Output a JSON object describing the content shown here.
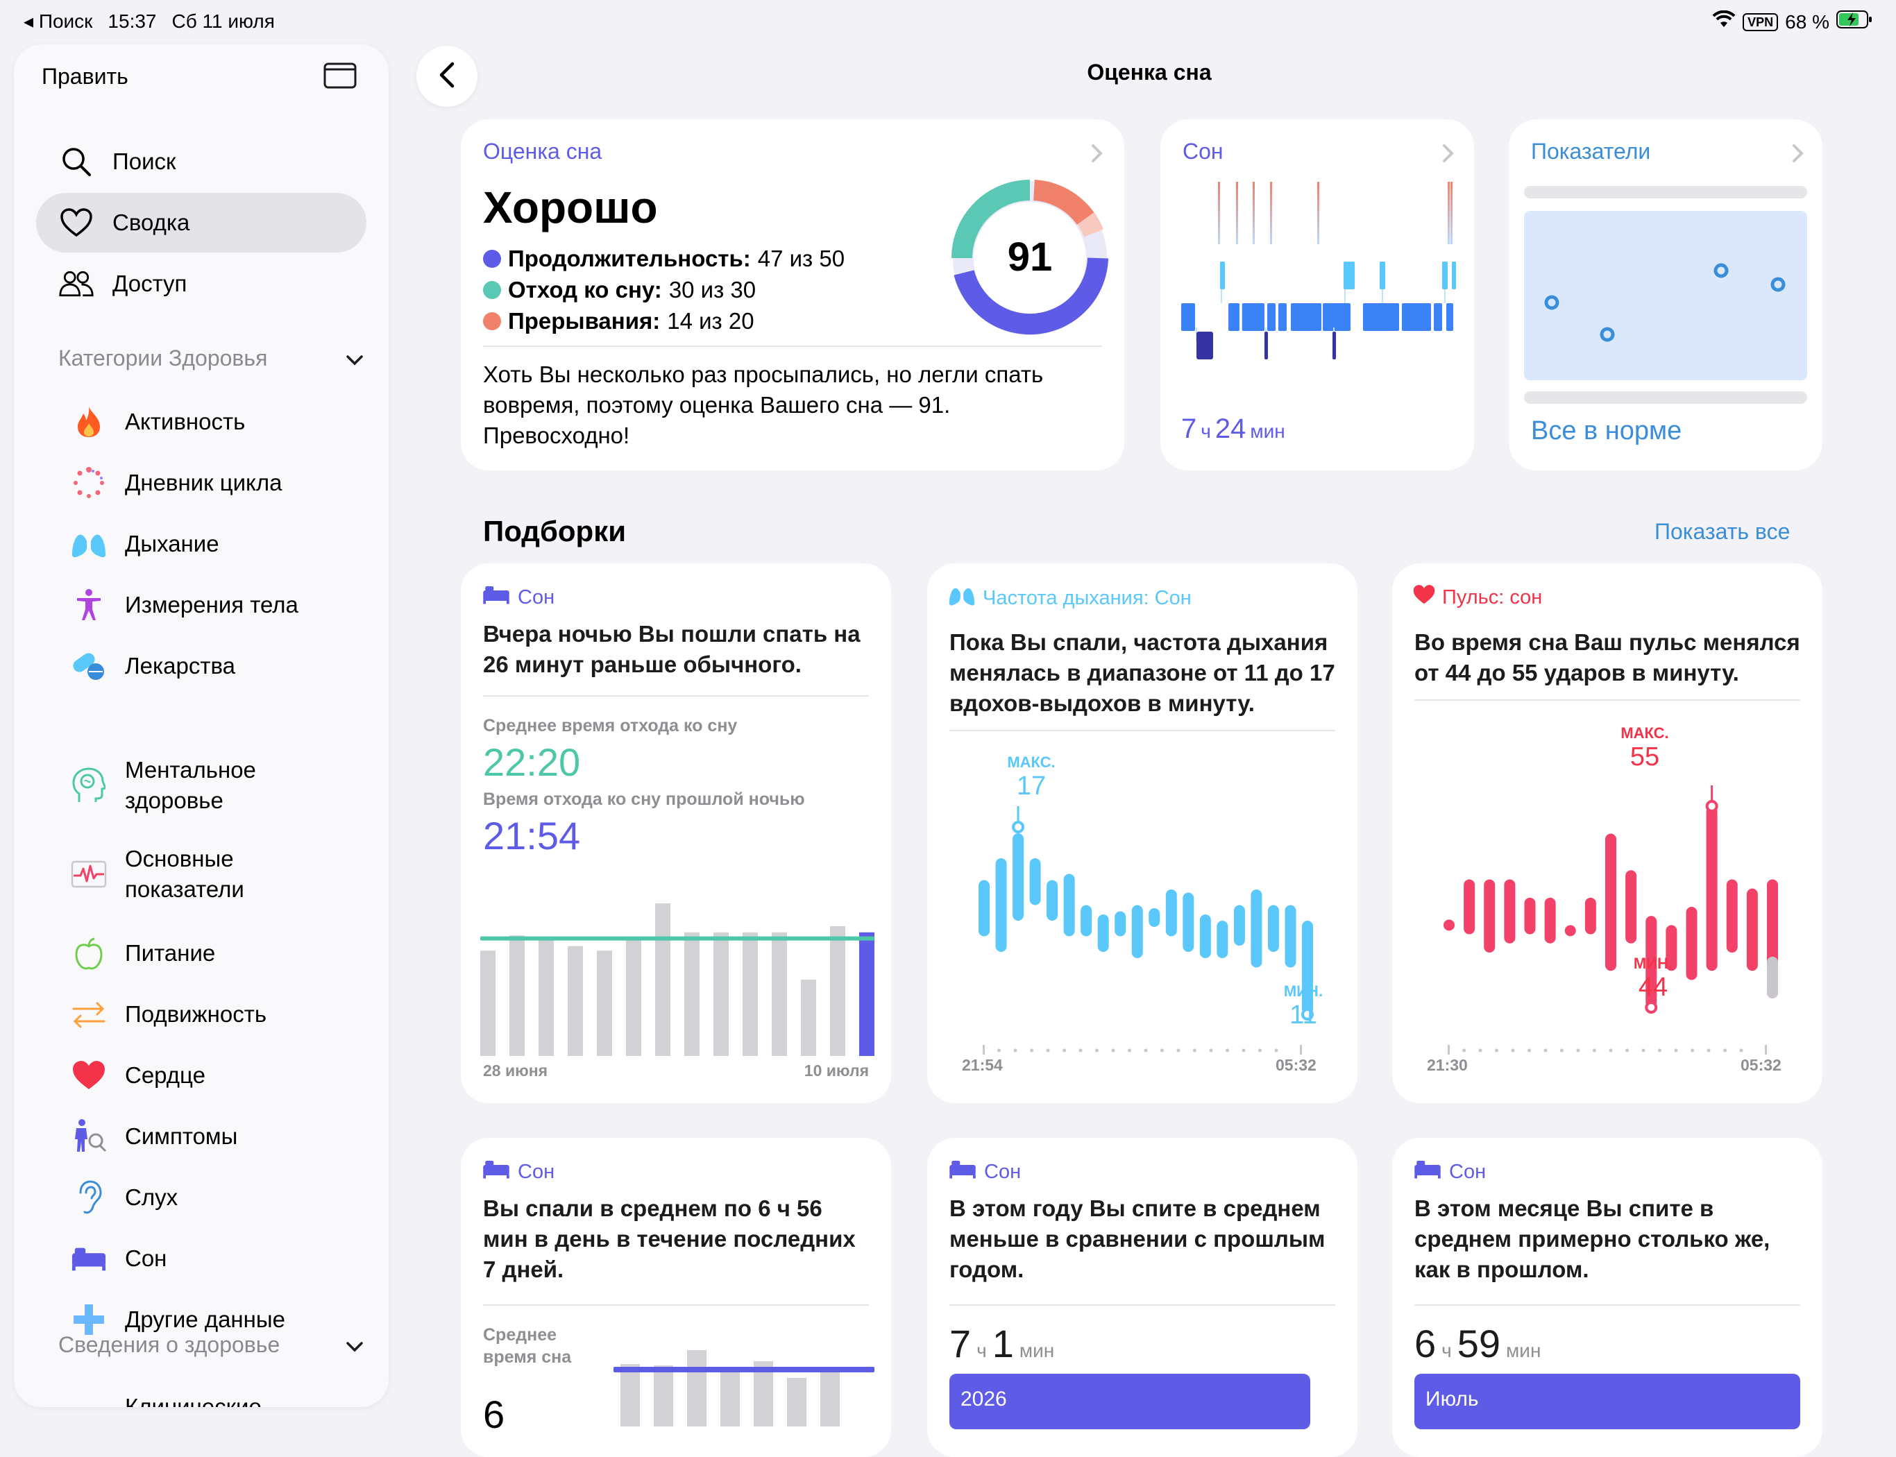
{
  "status_bar": {
    "back_app": "◂ Поиск",
    "time": "15:37",
    "date": "Сб 11 июля",
    "vpn": "VPN",
    "battery": "68 %"
  },
  "sidebar": {
    "edit": "Править",
    "items": [
      {
        "label": "Поиск",
        "icon": "search-icon"
      },
      {
        "label": "Сводка",
        "icon": "heart-outline-icon",
        "selected": true
      },
      {
        "label": "Доступ",
        "icon": "people-icon"
      }
    ],
    "categories_header": "Категории Здоровья",
    "categories": [
      {
        "label": "Активность",
        "icon": "flame-icon"
      },
      {
        "label": "Дневник цикла",
        "icon": "cycle-icon"
      },
      {
        "label": "Дыхание",
        "icon": "lungs-icon"
      },
      {
        "label": "Измерения тела",
        "icon": "body-icon"
      },
      {
        "label": "Лекарства",
        "icon": "pills-icon"
      },
      {
        "label": "Ментальное здоровье",
        "icon": "brain-head-icon"
      },
      {
        "label": "Основные показатели",
        "icon": "vitals-icon"
      },
      {
        "label": "Питание",
        "icon": "apple-icon"
      },
      {
        "label": "Подвижность",
        "icon": "arrows-icon"
      },
      {
        "label": "Сердце",
        "icon": "heart-icon"
      },
      {
        "label": "Симптомы",
        "icon": "symptoms-icon"
      },
      {
        "label": "Слух",
        "icon": "ear-icon"
      },
      {
        "label": "Сон",
        "icon": "bed-icon"
      },
      {
        "label": "Другие данные",
        "icon": "plus-icon"
      }
    ],
    "records_header": "Сведения о здоровье",
    "clinical_partial": "Клинические"
  },
  "page": {
    "title": "Оценка сна",
    "back": "back"
  },
  "score_card": {
    "head": "Оценка сна",
    "rating": "Хорошо",
    "score": "91",
    "duration_label": "Продолжительность:",
    "duration_value": "47 из 50",
    "bedtime_label": "Отход ко сну:",
    "bedtime_value": "30 из 30",
    "interrupt_label": "Прерывания:",
    "interrupt_value": "14 из 20",
    "description": "Хоть Вы несколько раз просыпались, но легли спать вовремя, поэтому оценка Вашего сна — 91. Превосходно!",
    "colors": {
      "duration": "#5e5ce6",
      "bedtime": "#5ac8b4",
      "interrupt": "#f0826c"
    }
  },
  "sleep_card": {
    "head": "Сон",
    "hours": "7",
    "h_unit": "ч",
    "minutes": "24",
    "m_unit": "мин"
  },
  "vitals_card": {
    "head": "Показатели",
    "status": "Все в норме"
  },
  "highlights": {
    "title": "Подборки",
    "show_all": "Показать все"
  },
  "hl_sleep": {
    "head": "Сон",
    "text": "Вчера ночью Вы пошли спать на 26 минут раньше обычного.",
    "avg_label": "Среднее время отхода ко сну",
    "avg_value": "22:20",
    "last_label": "Время отхода ко сну прошлой ночью",
    "last_value": "21:54",
    "start": "28 июня",
    "end": "10 июля"
  },
  "hl_resp": {
    "head": "Частота дыхания: Сон",
    "text": "Пока Вы спали, частота дыхания менялась в диапазоне от 11 до 17 вдохов-выдохов в минуту.",
    "max_label": "МАКС.",
    "max_value": "17",
    "min_label": "МИН.",
    "min_value": "11",
    "start": "21:54",
    "end": "05:32"
  },
  "hl_pulse": {
    "head": "Пульс: сон",
    "text": "Во время сна Ваш пульс менялся от 44 до 55 ударов в минуту.",
    "max_label": "МАКС.",
    "max_value": "55",
    "min_label": "МИН.",
    "min_value": "44",
    "start": "21:30",
    "end": "05:32"
  },
  "hl_week": {
    "head": "Сон",
    "text": "Вы спали в среднем по 6 ч 56 мин в день в течение последних 7 дней.",
    "avg_label": "Среднее время сна",
    "partial_value": "6"
  },
  "hl_year": {
    "head": "Сон",
    "text": "В этом году Вы спите в среднем меньше в сравнении с прошлым годом.",
    "hours": "7",
    "h_unit": "ч",
    "minutes": "1",
    "m_unit": "мин",
    "bar_label": "2026"
  },
  "hl_month": {
    "head": "Сон",
    "text": "В этом месяце Вы спите в среднем примерно столько же, как в прошлом.",
    "hours": "6",
    "h_unit": "ч",
    "minutes": "59",
    "m_unit": "мин",
    "bar_label": "Июль"
  },
  "chart_data": [
    {
      "type": "bar",
      "title": "Среднее время отхода ко сну",
      "categories": [
        "28 июня",
        "",
        "",
        "",
        "",
        "",
        "",
        "",
        "",
        "",
        "",
        "",
        "",
        "10 июля"
      ],
      "values": [
        0.69,
        0.79,
        0.76,
        0.72,
        0.69,
        0.77,
        1.0,
        0.81,
        0.81,
        0.81,
        0.81,
        0.5,
        0.85,
        0.81
      ],
      "average_line": 0.77,
      "highlight_last": true
    },
    {
      "type": "bar",
      "title": "Частота дыхания: Сон",
      "x_range": [
        "21:54",
        "05:32"
      ],
      "series": [
        {
          "name": "range",
          "ranges": [
            [
              13.5,
              15.3
            ],
            [
              13,
              16
            ],
            [
              14,
              16.8
            ],
            [
              14.5,
              16
            ],
            [
              14,
              15.3
            ],
            [
              13.5,
              15.5
            ],
            [
              13.5,
              14.5
            ],
            [
              13,
              14.2
            ],
            [
              13.5,
              14.3
            ],
            [
              12.8,
              14.5
            ],
            [
              13.8,
              14.4
            ],
            [
              13.5,
              15
            ],
            [
              13,
              14.9
            ],
            [
              12.8,
              14.2
            ],
            [
              12.8,
              14
            ],
            [
              13.2,
              14.5
            ],
            [
              12.5,
              15
            ],
            [
              13,
              14.5
            ],
            [
              12.5,
              14.5
            ],
            [
              11,
              14
            ]
          ]
        }
      ],
      "ylim": [
        11,
        17
      ]
    },
    {
      "type": "bar",
      "title": "Пульс: сон",
      "x_range": [
        "21:30",
        "05:32"
      ],
      "series": [
        {
          "name": "range",
          "ranges": [
            [
              48.5,
              48.5
            ],
            [
              48,
              51
            ],
            [
              47,
              51
            ],
            [
              47.5,
              51
            ],
            [
              48,
              50
            ],
            [
              47.5,
              50
            ],
            [
              48,
              48.5
            ],
            [
              48,
              50
            ],
            [
              46,
              53.5
            ],
            [
              47.5,
              51.5
            ],
            [
              44,
              49
            ],
            [
              46,
              48.5
            ],
            [
              45.5,
              49.5
            ],
            [
              46,
              55
            ],
            [
              47,
              51
            ],
            [
              46,
              50.5
            ],
            [
              44.5,
              51
            ]
          ]
        }
      ],
      "ylim": [
        44,
        55
      ]
    }
  ]
}
